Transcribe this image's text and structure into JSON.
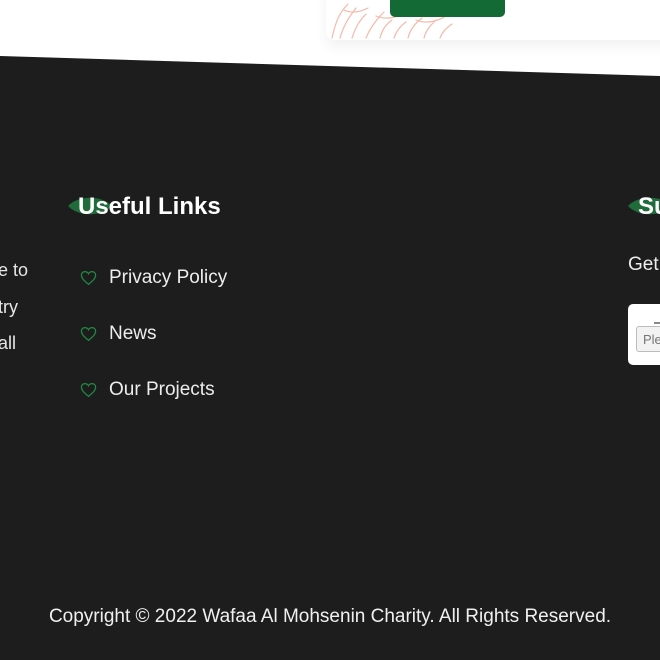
{
  "colors": {
    "footer_bg": "#1d1d1d",
    "accent_green": "#136a35",
    "leaf_green": "#1f6b3a",
    "text_light": "#ededed",
    "illustration": "#f4b9a8"
  },
  "footer": {
    "about_lines": [
      "e to",
      "try",
      "all"
    ],
    "useful_links": {
      "heading": "Useful Links",
      "icon": "heart-outline-icon",
      "items": [
        {
          "label": "Privacy Policy"
        },
        {
          "label": "News"
        },
        {
          "label": "Our Projects"
        }
      ]
    },
    "subscribe": {
      "heading": "Su",
      "text": "Get",
      "email_placeholder": "Ple"
    },
    "copyright": "Copyright © 2022 Wafaa Al Mohsenin Charity. All Rights Reserved."
  }
}
